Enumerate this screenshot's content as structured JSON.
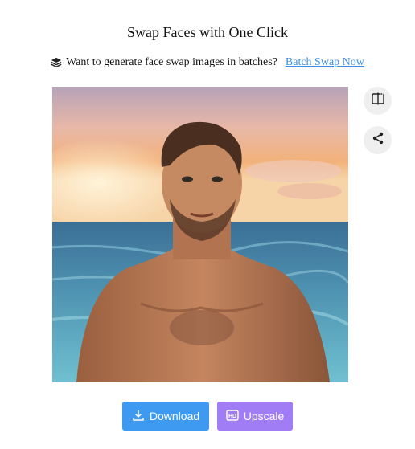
{
  "header": {
    "title": "Swap Faces with One Click"
  },
  "promo": {
    "icon": "layers-icon",
    "text": "Want to generate face swap images in batches?",
    "link_label": "Batch Swap Now",
    "link_color": "#3b8fe8"
  },
  "preview": {
    "alt": "Face swap result: shirtless man on beach at sunset"
  },
  "side_actions": {
    "compare_icon": "compare-icon",
    "share_icon": "share-icon"
  },
  "actions": {
    "download_label": "Download",
    "download_icon": "download-icon",
    "download_color": "#3d9af0",
    "upscale_label": "Upscale",
    "upscale_icon": "hd-icon",
    "upscale_color": "#a07cf5"
  }
}
